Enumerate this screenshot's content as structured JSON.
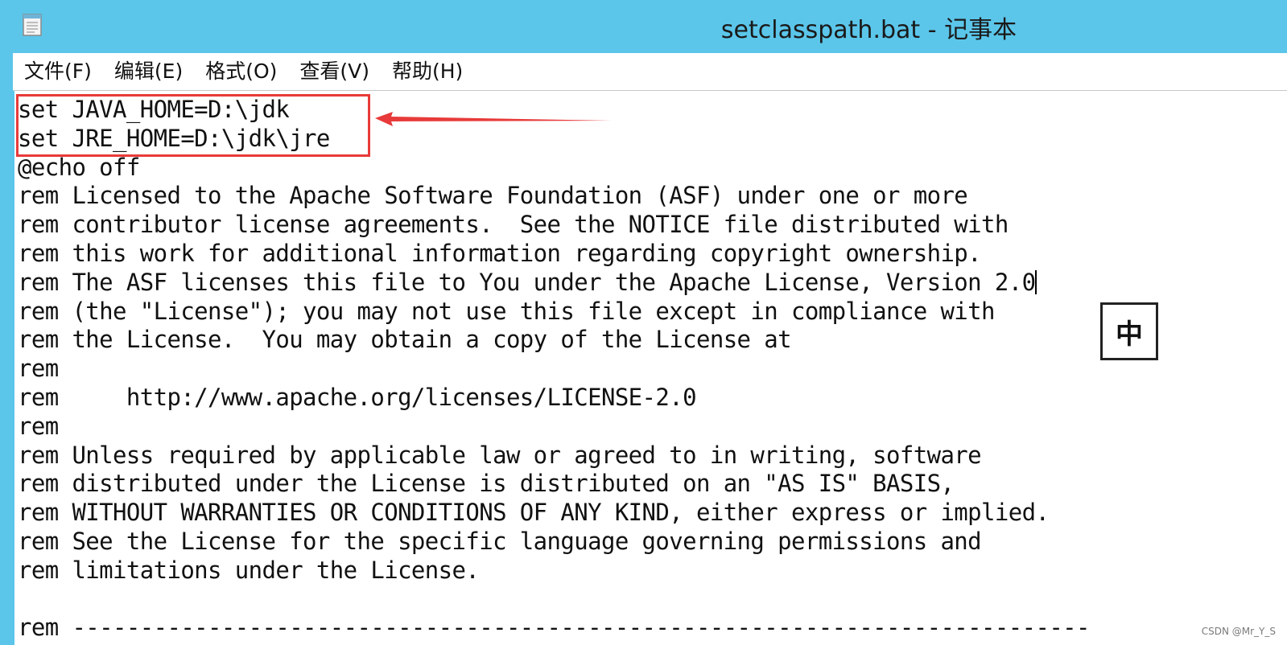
{
  "window": {
    "title": "setclasspath.bat - 记事本"
  },
  "menu": [
    {
      "label": "文件(F)"
    },
    {
      "label": "编辑(E)"
    },
    {
      "label": "格式(O)"
    },
    {
      "label": "查看(V)"
    },
    {
      "label": "帮助(H)"
    }
  ],
  "editor": {
    "lines": [
      "set JAVA_HOME=D:\\jdk",
      "set JRE_HOME=D:\\jdk\\jre",
      "@echo off",
      "rem Licensed to the Apache Software Foundation (ASF) under one or more",
      "rem contributor license agreements.  See the NOTICE file distributed with",
      "rem this work for additional information regarding copyright ownership.",
      "rem The ASF licenses this file to You under the Apache License, Version 2.0",
      "rem (the \"License\"); you may not use this file except in compliance with",
      "rem the License.  You may obtain a copy of the License at",
      "rem",
      "rem     http://www.apache.org/licenses/LICENSE-2.0",
      "rem",
      "rem Unless required by applicable law or agreed to in writing, software",
      "rem distributed under the License is distributed on an \"AS IS\" BASIS,",
      "rem WITHOUT WARRANTIES OR CONDITIONS OF ANY KIND, either express or implied.",
      "rem See the License for the specific language governing permissions and",
      "rem limitations under the License.",
      "",
      "rem ---------------------------------------------------------------------------"
    ],
    "caret_line": 6
  },
  "ime": {
    "mode": "中"
  },
  "watermark": {
    "text": "CSDN @Mr_Y_S"
  },
  "colors": {
    "titlebar": "#5bc6ea",
    "highlight": "#e83a3a"
  }
}
